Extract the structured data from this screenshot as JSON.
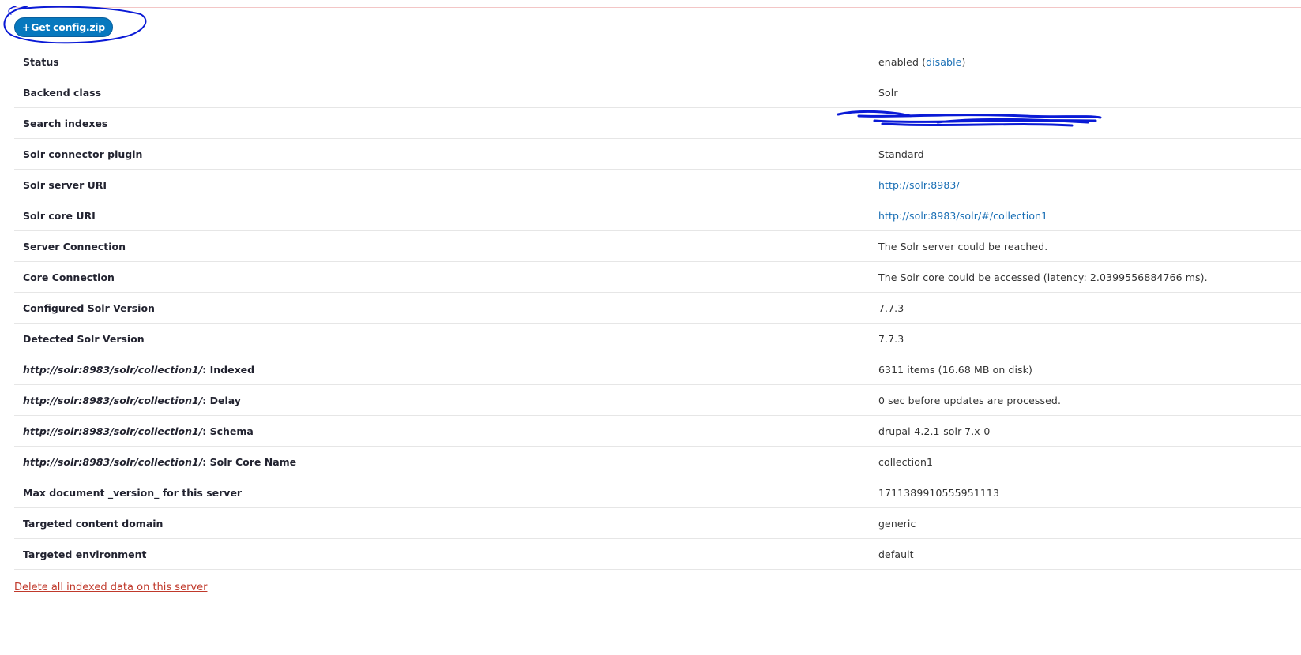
{
  "actions": {
    "get_config_label": "Get config.zip",
    "get_config_plus": "+"
  },
  "rows": [
    {
      "label": "Status",
      "value": "enabled (",
      "link": "disable",
      "after": ")"
    },
    {
      "label": "Backend class",
      "value": "Solr"
    },
    {
      "label": "Search indexes",
      "value": ""
    },
    {
      "label": "Solr connector plugin",
      "value": "Standard"
    },
    {
      "label": "Solr server URI",
      "link": "http://solr:8983/"
    },
    {
      "label": "Solr core URI",
      "link": "http://solr:8983/solr/#/collection1"
    },
    {
      "label": "Server Connection",
      "value": "The Solr server could be reached."
    },
    {
      "label": "Core Connection",
      "value": "The Solr core could be accessed (latency: 2.0399556884766 ms)."
    },
    {
      "label": "Configured Solr Version",
      "value": "7.7.3"
    },
    {
      "label": "Detected Solr Version",
      "value": "7.7.3"
    },
    {
      "uri": "http://solr:8983/solr/collection1/",
      "suffix": ": Indexed",
      "value": "6311 items (16.68 MB on disk)"
    },
    {
      "uri": "http://solr:8983/solr/collection1/",
      "suffix": ": Delay",
      "value": "0 sec before updates are processed."
    },
    {
      "uri": "http://solr:8983/solr/collection1/",
      "suffix": ": Schema",
      "value": "drupal-4.2.1-solr-7.x-0"
    },
    {
      "uri": "http://solr:8983/solr/collection1/",
      "suffix": ": Solr Core Name",
      "value": "collection1"
    },
    {
      "label": "Max document _version_ for this server",
      "value": "1711389910555951113"
    },
    {
      "label": "Targeted content domain",
      "value": "generic"
    },
    {
      "label": "Targeted environment",
      "value": "default"
    }
  ],
  "footer": {
    "delete_label": "Delete all indexed data on this server"
  },
  "colors": {
    "button_bg": "#0678be",
    "link": "#1a6fb5",
    "danger": "#c0392b",
    "annotation": "#0a1ad6"
  }
}
